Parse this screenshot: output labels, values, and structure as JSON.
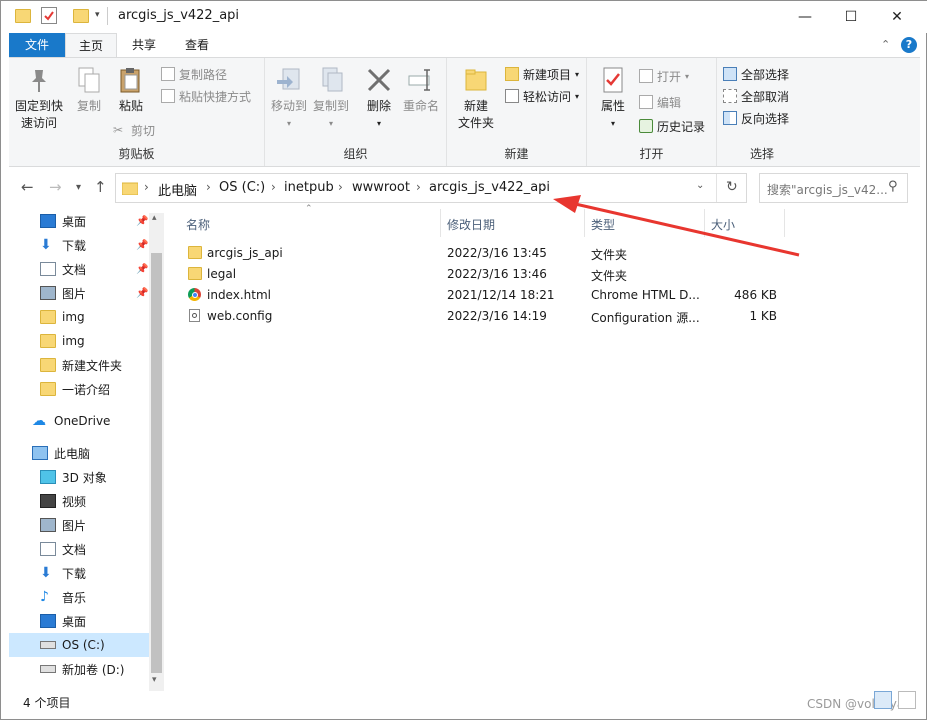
{
  "window": {
    "title": "arcgis_js_v422_api",
    "minimize": "—",
    "maximize": "☐",
    "close": "✕"
  },
  "tabs": [
    "文件",
    "主页",
    "共享",
    "查看"
  ],
  "ribbon": {
    "clipboard": {
      "pin": "固定到快\n速访问",
      "pin_line1": "固定到快",
      "pin_line2": "速访问",
      "copy": "复制",
      "paste": "粘贴",
      "copy_path": "复制路径",
      "paste_shortcut": "粘贴快捷方式",
      "cut": "剪切",
      "group": "剪贴板"
    },
    "organize": {
      "move_to": "移动到",
      "copy_to": "复制到",
      "delete": "删除",
      "rename": "重命名",
      "group": "组织"
    },
    "new": {
      "new_folder_line1": "新建",
      "new_folder_line2": "文件夹",
      "new_item": "新建项目",
      "easy_access": "轻松访问",
      "group": "新建"
    },
    "open": {
      "properties": "属性",
      "open": "打开",
      "edit": "编辑",
      "history": "历史记录",
      "group": "打开"
    },
    "select": {
      "select_all": "全部选择",
      "select_none": "全部取消",
      "invert": "反向选择",
      "group": "选择"
    }
  },
  "address": {
    "crumbs": [
      "此电脑",
      "OS (C:)",
      "inetpub",
      "wwwroot",
      "arcgis_js_v422_api"
    ],
    "search_placeholder": "搜索\"arcgis_js_v42..."
  },
  "nav": {
    "quick_access": [
      {
        "label": "桌面",
        "icon": "desktop-icon",
        "pinned": true
      },
      {
        "label": "下载",
        "icon": "download-icon",
        "pinned": true
      },
      {
        "label": "文档",
        "icon": "document-icon",
        "pinned": true
      },
      {
        "label": "图片",
        "icon": "picture-icon",
        "pinned": true
      },
      {
        "label": "img",
        "icon": "folder-icon",
        "pinned": false
      },
      {
        "label": "img",
        "icon": "folder-icon",
        "pinned": false
      },
      {
        "label": "新建文件夹",
        "icon": "folder-icon",
        "pinned": false
      },
      {
        "label": "一诺介绍",
        "icon": "folder-icon",
        "pinned": false
      }
    ],
    "onedrive": "OneDrive",
    "this_pc": "此电脑",
    "pc_items": [
      {
        "label": "3D 对象",
        "icon": "3d-objects-icon"
      },
      {
        "label": "视频",
        "icon": "video-icon"
      },
      {
        "label": "图片",
        "icon": "picture-icon"
      },
      {
        "label": "文档",
        "icon": "document-icon"
      },
      {
        "label": "下载",
        "icon": "download-icon"
      },
      {
        "label": "音乐",
        "icon": "music-icon"
      },
      {
        "label": "桌面",
        "icon": "desktop-icon"
      },
      {
        "label": "OS (C:)",
        "icon": "drive-icon",
        "selected": true
      },
      {
        "label": "新加卷 (D:)",
        "icon": "drive-icon"
      }
    ]
  },
  "columns": {
    "name": "名称",
    "date": "修改日期",
    "type": "类型",
    "size": "大小"
  },
  "files": [
    {
      "name": "arcgis_js_api",
      "date": "2022/3/16 13:45",
      "type": "文件夹",
      "size": "",
      "icon": "folder-icon"
    },
    {
      "name": "legal",
      "date": "2022/3/16 13:46",
      "type": "文件夹",
      "size": "",
      "icon": "folder-icon"
    },
    {
      "name": "index.html",
      "date": "2021/12/14 18:21",
      "type": "Chrome HTML D...",
      "size": "486 KB",
      "icon": "chrome-icon"
    },
    {
      "name": "web.config",
      "date": "2022/3/16 14:19",
      "type": "Configuration 源...",
      "size": "1 KB",
      "icon": "config-file-icon"
    }
  ],
  "status": "4 个项目",
  "watermark": "CSDN @volodyan",
  "colors": {
    "accent": "#1979ca",
    "selected": "#cce8ff",
    "arrow": "#e8362f",
    "folder": "#f8d775"
  }
}
